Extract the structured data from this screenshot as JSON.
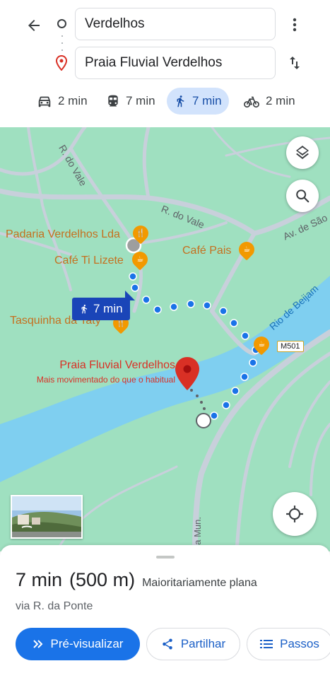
{
  "directions": {
    "origin_value": "Verdelhos",
    "destination_value": "Praia Fluvial Verdelhos"
  },
  "modes": [
    {
      "icon": "car-icon",
      "time": "2 min"
    },
    {
      "icon": "transit-icon",
      "time": "7 min"
    },
    {
      "icon": "walk-icon",
      "time": "7 min",
      "selected": true
    },
    {
      "icon": "bike-icon",
      "time": "2 min"
    }
  ],
  "map": {
    "roads": {
      "r_do_vale_1": "R. do Vale",
      "r_do_vale_2": "R. do Vale",
      "av_de_sao": "Av. de São",
      "rio": "Rio de Beijam",
      "highway": "M501",
      "da_mun": "da Mun."
    },
    "places": {
      "padaria": "Padaria Verdelhos Lda",
      "cafe_ti_lizete": "Café Ti Lizete",
      "cafe_pais": "Café Pais",
      "tasquinha": "Tasquinha da Taty"
    },
    "route_chip": "7 min",
    "destination": {
      "name": "Praia Fluvial Verdelhos",
      "busyness": "Mais movimentado do que o habitual"
    },
    "colors": {
      "land": "#9fe0c0",
      "water": "#7fcff0",
      "road": "#c8d0db",
      "route": "#1a73e8",
      "accent": "#1a73e8",
      "destination": "#d93025"
    }
  },
  "sheet": {
    "duration": "7 min",
    "distance": "(500 m)",
    "terrain": "Maioritariamente plana",
    "via": "via R. da Ponte",
    "preview_label": "Pré-visualizar",
    "share_label": "Partilhar",
    "steps_label": "Passos"
  }
}
